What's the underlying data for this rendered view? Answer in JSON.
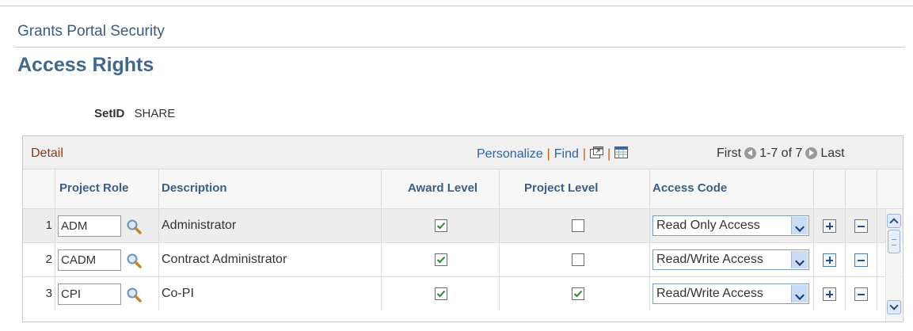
{
  "header": {
    "portal_title": "Grants Portal Security",
    "page_title": "Access Rights"
  },
  "setid": {
    "label": "SetID",
    "value": "SHARE"
  },
  "grid": {
    "title": "Detail",
    "toolbar": {
      "personalize": "Personalize",
      "find": "Find",
      "separator": "|",
      "view_all_icon": "new-window-icon",
      "download_icon": "spreadsheet-icon"
    },
    "navigation": {
      "first": "First",
      "range": "1-7 of 7",
      "last": "Last"
    },
    "columns": {
      "project_role": "Project Role",
      "description": "Description",
      "award_level": "Award Level",
      "project_level": "Project Level",
      "access_code": "Access Code"
    },
    "rows": [
      {
        "num": "1",
        "project_role": "ADM",
        "description": "Administrator",
        "award_level": true,
        "project_level": false,
        "access_code": "Read Only Access"
      },
      {
        "num": "2",
        "project_role": "CADM",
        "description": "Contract Administrator",
        "award_level": true,
        "project_level": false,
        "access_code": "Read/Write Access"
      },
      {
        "num": "3",
        "project_role": "CPI",
        "description": "Co-PI",
        "award_level": true,
        "project_level": true,
        "access_code": "Read/Write Access"
      }
    ]
  },
  "icons": {
    "lookup": "magnifier-icon",
    "add_row": "plus-icon",
    "delete_row": "minus-icon",
    "checkmark": "checkmark-icon"
  },
  "colors": {
    "title": "#3f6891",
    "detail": "#8b3a0f",
    "link": "#2d63a8",
    "check": "#2c8a2c"
  }
}
